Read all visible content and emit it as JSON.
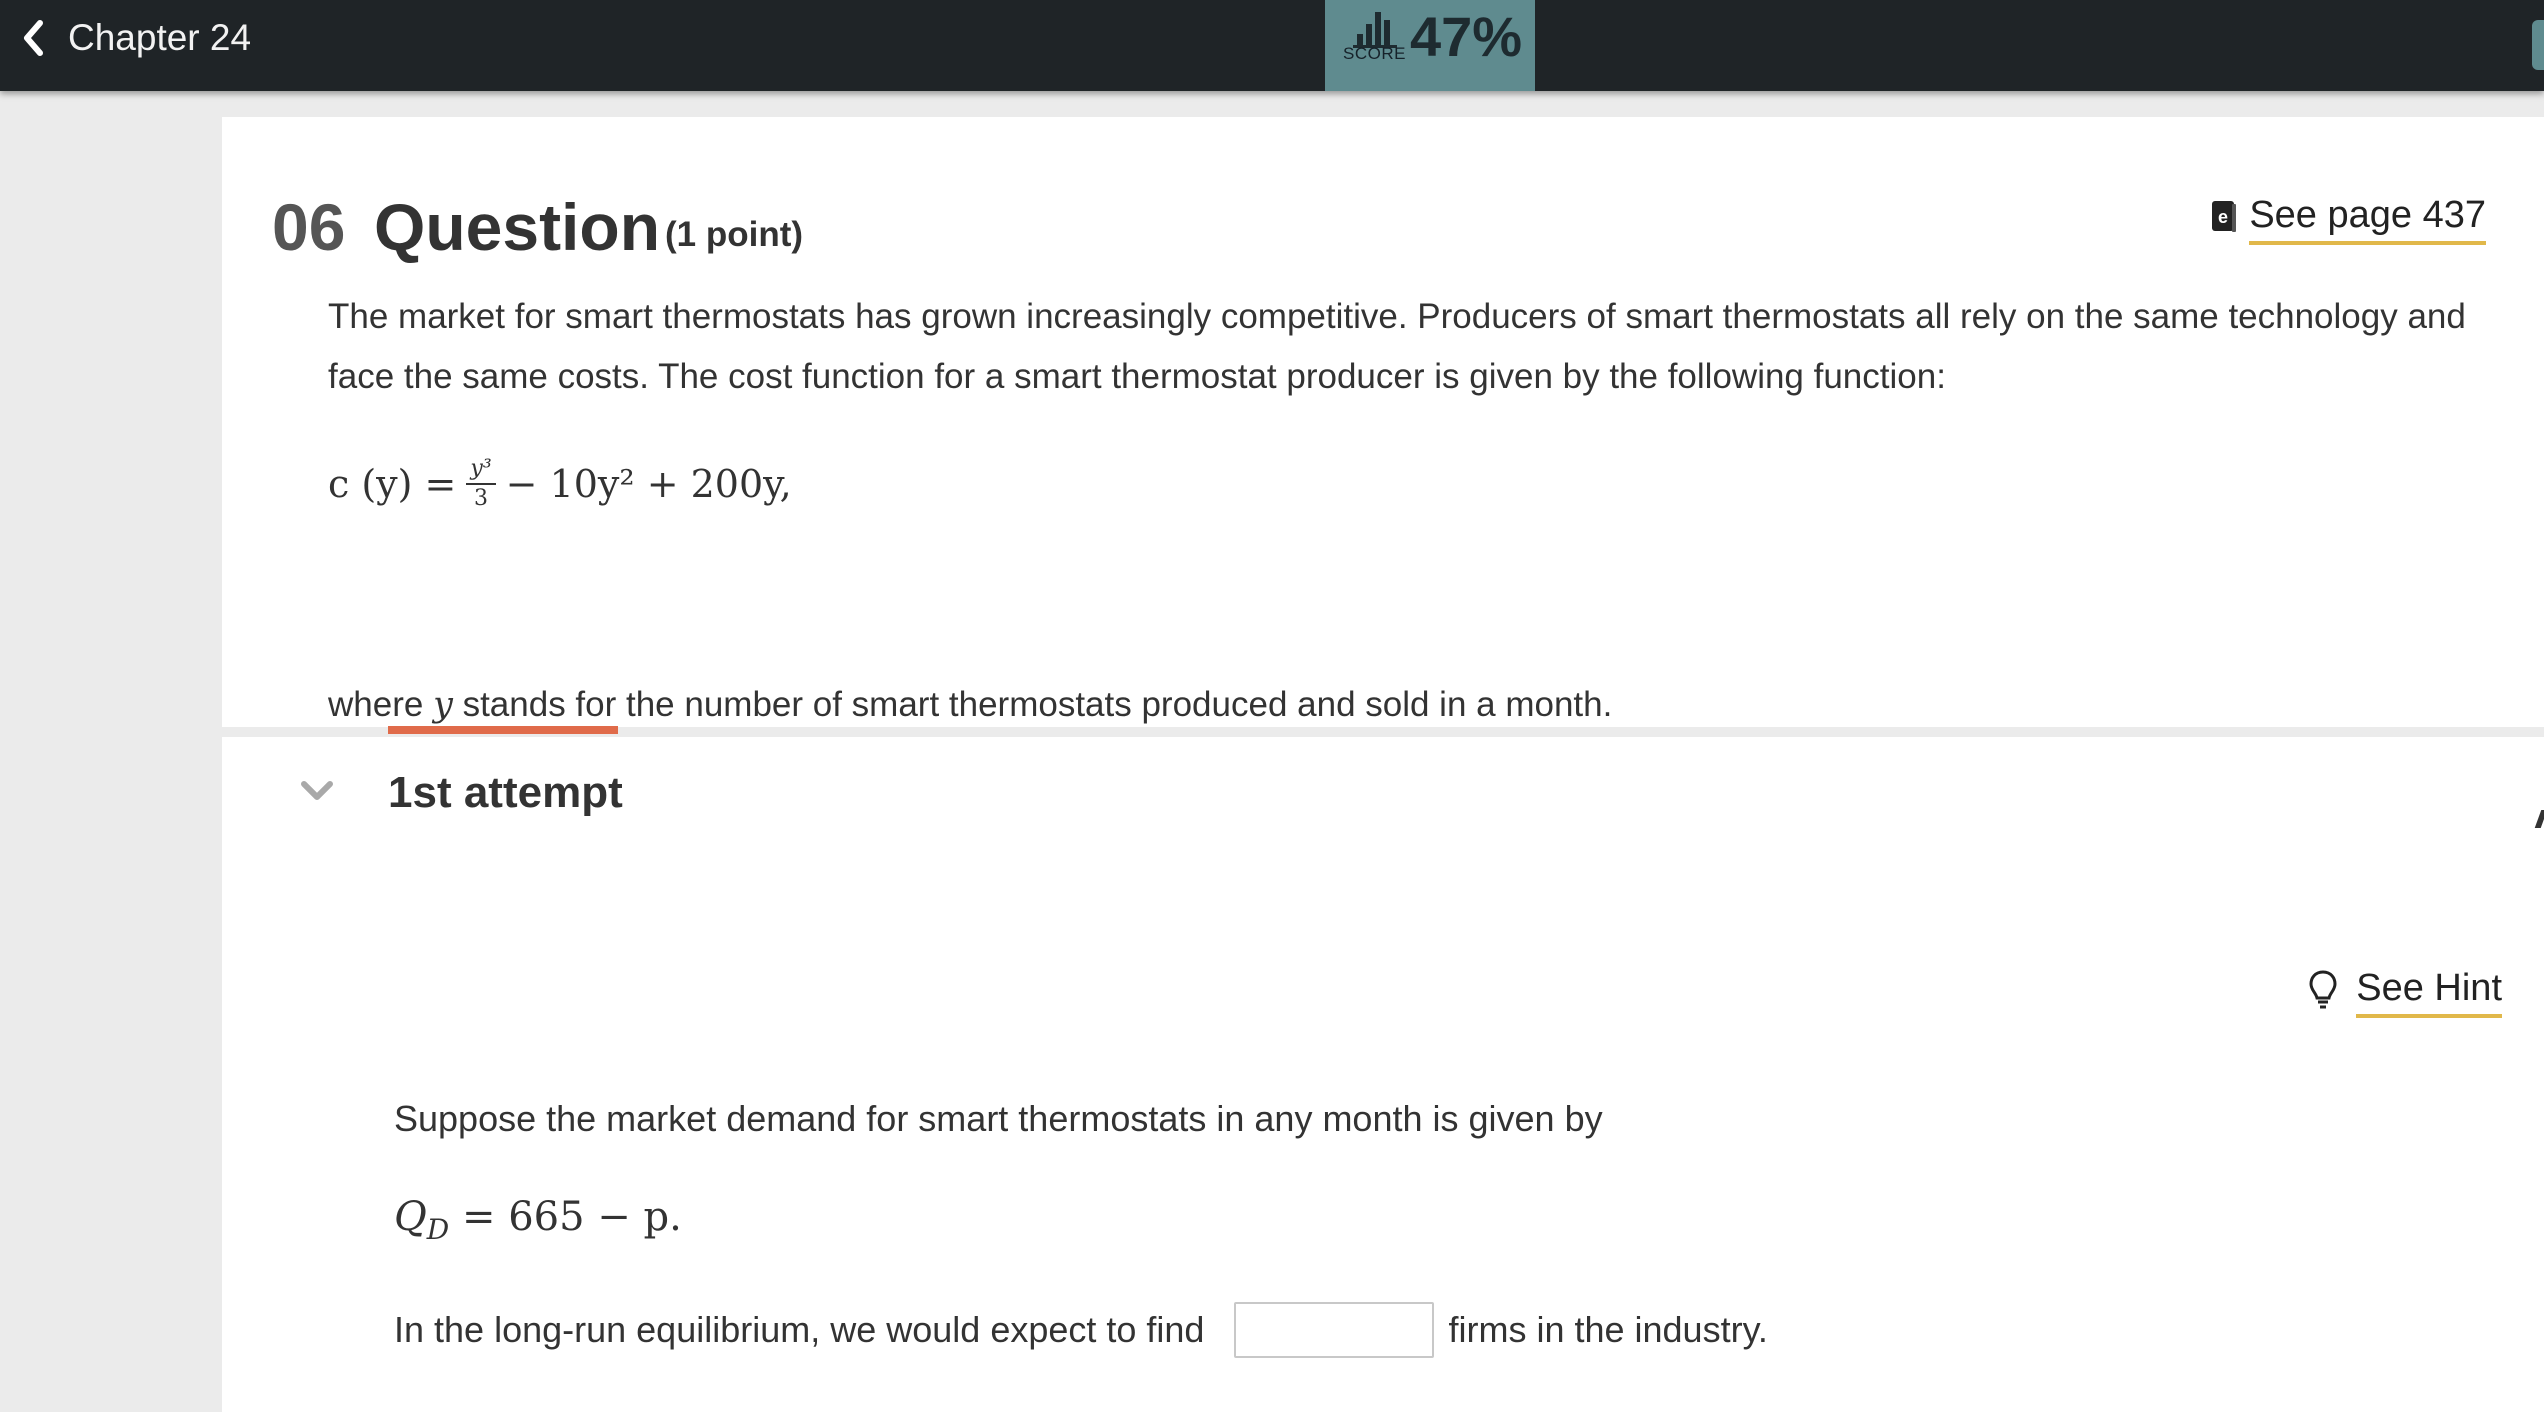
{
  "header": {
    "back_label": "Chapter 24",
    "score_label": "SCORE",
    "score_value": "47%",
    "accent_color": "#5f8b8f"
  },
  "question": {
    "number": "06",
    "title": "Question",
    "points": "(1 point)",
    "see_page_label": "See page 437",
    "paragraph": "The market for smart thermostats has grown increasingly competitive. Producers of smart thermostats all rely on the same technology and face the same costs. The cost function for a smart thermostat producer is given by the following function:",
    "formula": {
      "lhs": "c (y) = ",
      "frac_num": "y³",
      "frac_den": "3",
      "rhs": " − 10y² + 200y,"
    },
    "where_prefix": "where ",
    "where_var": "y",
    "where_suffix": " stands for the number of smart thermostats produced and sold in a month."
  },
  "attempt": {
    "label": "1st attempt",
    "accent_color": "#e06b4a",
    "see_hint_label": "See Hint",
    "intro": "Suppose the market demand for smart thermostats in any month is given by",
    "demand": {
      "q": "Q",
      "sub": "D",
      "rhs": "  = 665 − p."
    },
    "answer_prefix": "In the long-run equilibrium, we would expect to find",
    "answer_value": "",
    "answer_suffix": "firms in the industry."
  }
}
